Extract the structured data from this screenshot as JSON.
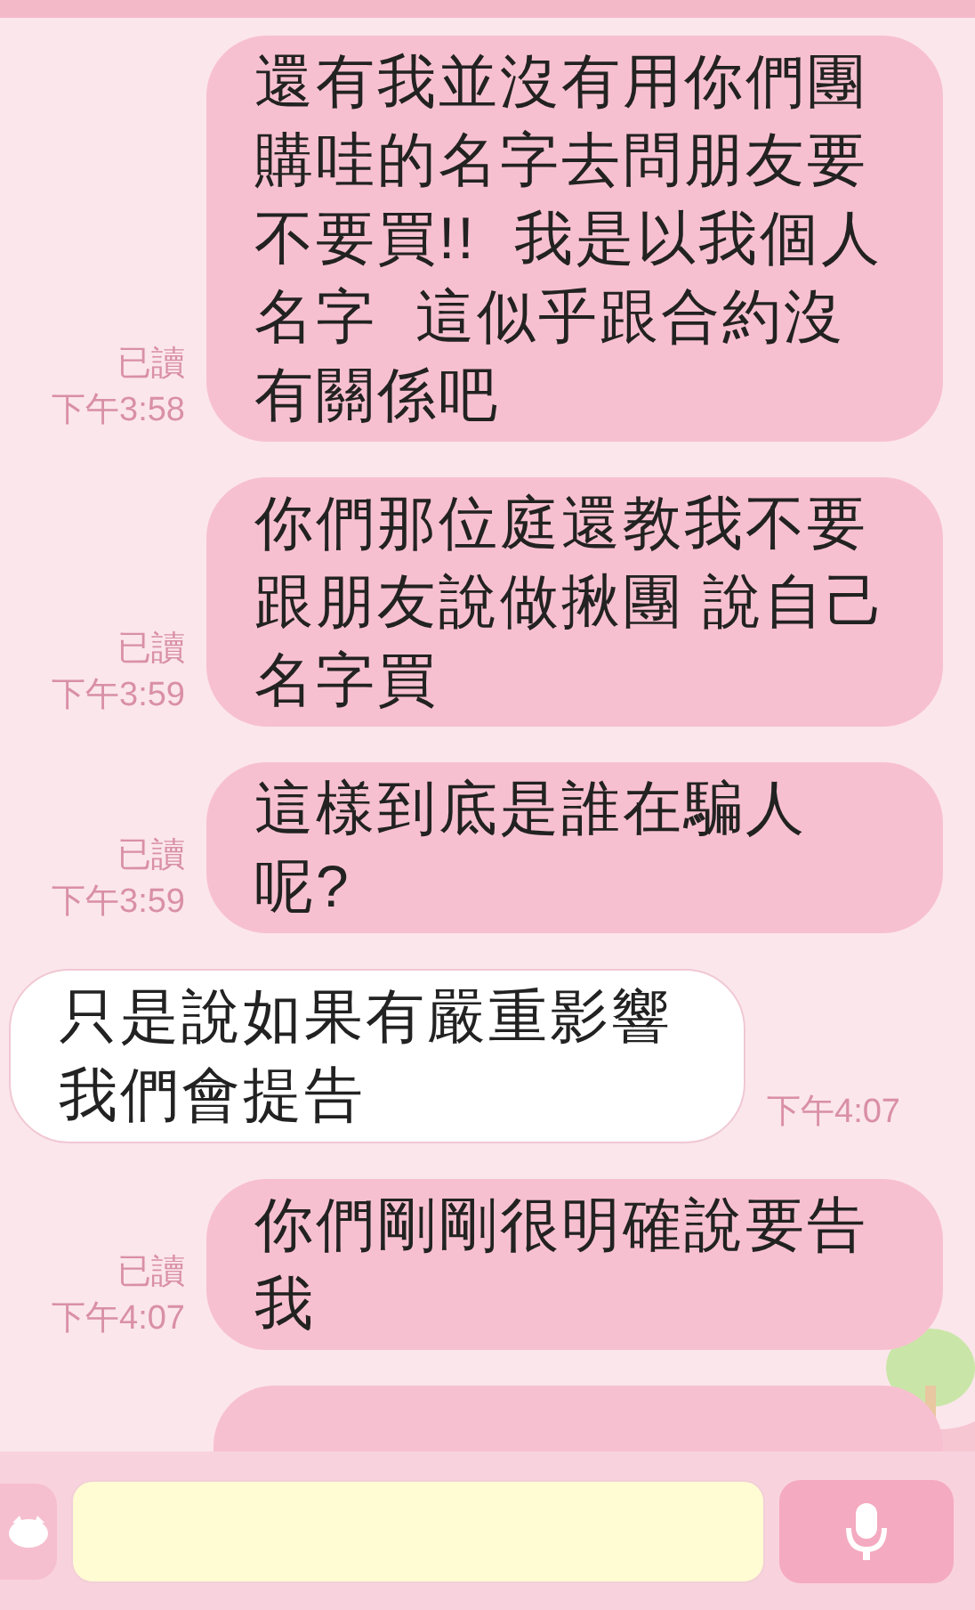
{
  "messages": [
    {
      "kind": "sent",
      "text": "還有我並沒有用你們團購哇的名字去問朋友要不要買!!  我是以我個人名字  這似乎跟合約沒有關係吧",
      "read_label": "已讀",
      "time": "下午3:58"
    },
    {
      "kind": "sent",
      "text": "你們那位庭還教我不要跟朋友說做揪團 說自己名字買",
      "read_label": "已讀",
      "time": "下午3:59"
    },
    {
      "kind": "sent",
      "text": "這樣到底是誰在騙人呢?",
      "read_label": "已讀",
      "time": "下午3:59"
    },
    {
      "kind": "received",
      "text": "只是說如果有嚴重影響我們會提告",
      "time": "下午4:07"
    },
    {
      "kind": "sent",
      "text": "你們剛剛很明確說要告我",
      "read_label": "已讀",
      "time": "下午4:07"
    }
  ]
}
